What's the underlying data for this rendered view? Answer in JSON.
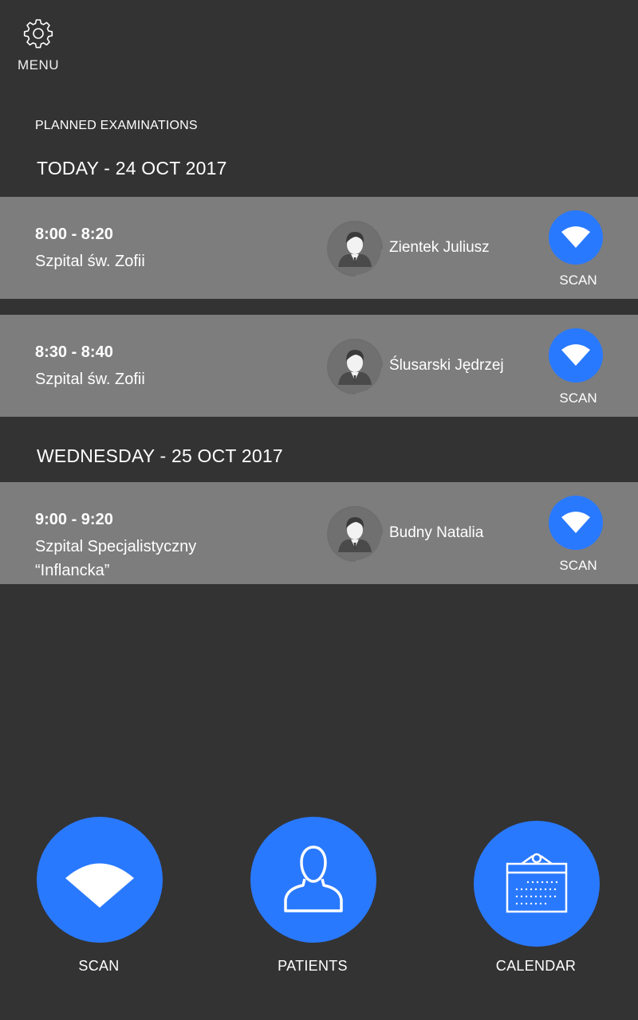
{
  "menu": {
    "label": "MENU",
    "icon": "gear-icon"
  },
  "section_title": "PLANNED EXAMINATIONS",
  "days": [
    {
      "heading": "TODAY - 24 OCT 2017"
    },
    {
      "heading": "WEDNESDAY - 25 OCT 2017"
    }
  ],
  "appointments": [
    {
      "time": "8:00 - 8:20",
      "place": "Szpital św. Zofii",
      "patient": "Zientek Juliusz",
      "scan_label": "SCAN"
    },
    {
      "time": "8:30 - 8:40",
      "place": "Szpital św. Zofii",
      "patient": "Ślusarski Jędrzej",
      "scan_label": "SCAN"
    },
    {
      "time": "9:00 - 9:20",
      "place": "Szpital Specjalistyczny “Inflancka”",
      "patient": "Budny Natalia",
      "scan_label": "SCAN"
    }
  ],
  "bottom_nav": {
    "scan": {
      "label": "SCAN",
      "icon": "wifi-icon"
    },
    "patients": {
      "label": "PATIENTS",
      "icon": "person-icon"
    },
    "calendar": {
      "label": "CALENDAR",
      "icon": "calendar-icon"
    }
  },
  "colors": {
    "background": "#333333",
    "card": "#7d7d7d",
    "accent": "#2979ff",
    "text": "#ffffff"
  }
}
